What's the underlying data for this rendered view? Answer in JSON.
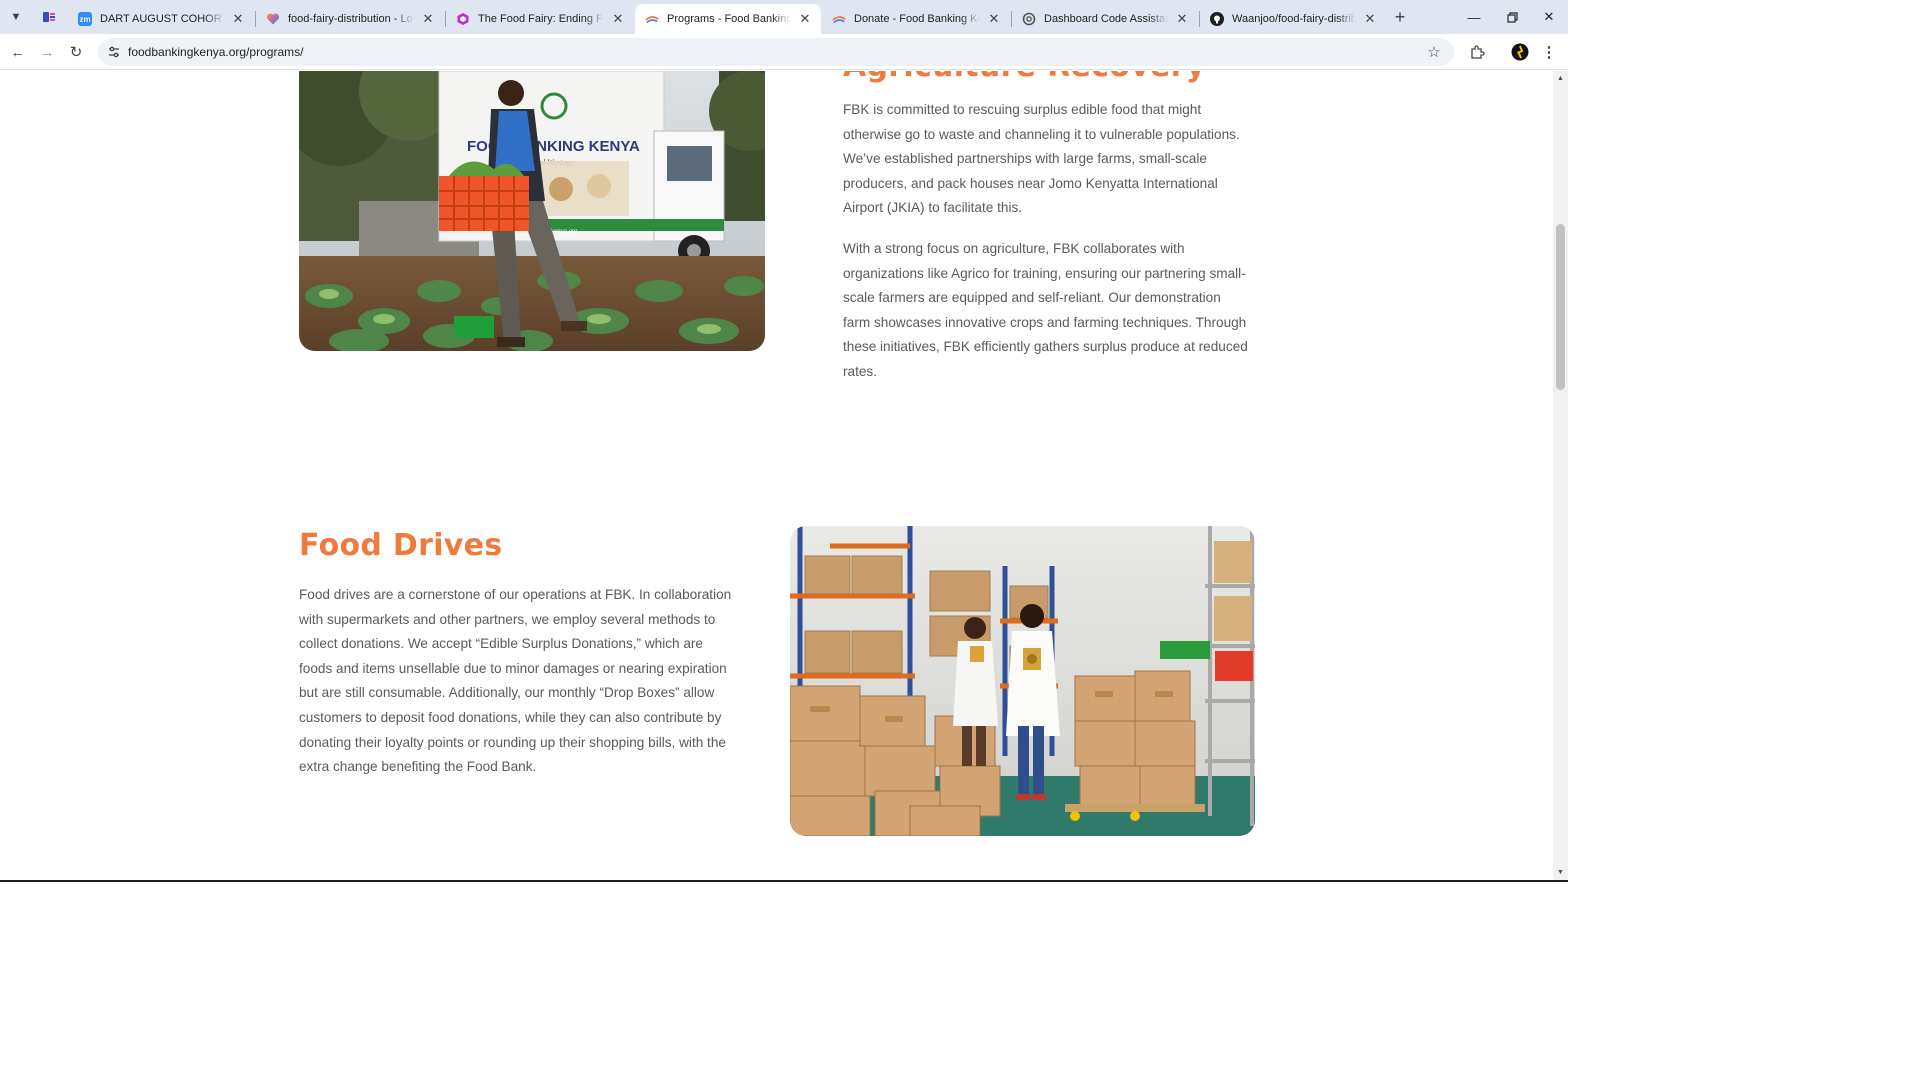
{
  "browser": {
    "tabs": [
      {
        "title": "",
        "favicon": "pinned-app-icon",
        "active": false
      },
      {
        "title": "DART AUGUST COHORT SESSION",
        "favicon": "zoom-icon",
        "active": false
      },
      {
        "title": "food-fairy-distribution - Lovable",
        "favicon": "lovable-heart-icon",
        "active": false
      },
      {
        "title": "The Food Fairy: Ending Food Waste",
        "favicon": "hexagon-logo-icon",
        "active": false
      },
      {
        "title": "Programs - Food Banking Kenya",
        "favicon": "fbk-logo-icon",
        "active": true
      },
      {
        "title": "Donate - Food Banking Kenya",
        "favicon": "fbk-logo-icon",
        "active": false
      },
      {
        "title": "Dashboard Code Assistance",
        "favicon": "openai-icon",
        "active": false
      },
      {
        "title": "Waanjoo/food-fairy-distribution",
        "favicon": "github-icon",
        "active": false
      }
    ],
    "new_tab": "+",
    "url": "foodbankingkenya.org/programs/"
  },
  "page": {
    "agri": {
      "title_partial": "Agriculture Recovery",
      "p1": "FBK is committed to rescuing surplus edible food that might otherwise go to waste and channeling it to vulnerable populations. We’ve established partnerships with large farms, small-scale producers, and pack houses near Jomo Kenyatta International Airport (JKIA) to facilitate this.",
      "p2": "With a strong focus on agriculture, FBK collaborates with organizations like Agrico for training, ensuring our partnering small-scale farmers are equipped and self-reliant. Our demonstration farm showcases innovative crops and farming techniques. Through these initiatives, FBK efficiently gathers surplus produce at reduced rates.",
      "truck_logo_text": "FOOD BANKING KENYA",
      "truck_tagline": "Tackling Food Wastage",
      "truck_site": "www.foodbankingkenya.org"
    },
    "drives": {
      "title": "Food Drives",
      "p1": "Food drives are a cornerstone of our operations at FBK. In collaboration with supermarkets and other partners, we employ several methods to collect donations. We accept “Edible Surplus Donations,” which are foods and items unsellable due to minor damages or nearing expiration but are still consumable. Additionally, our monthly “Drop Boxes” allow customers to deposit food donations, while they can also contribute by donating their loyalty points or rounding up their shopping bills, with the extra change benefiting the Food Bank."
    }
  },
  "colors": {
    "accent": "#f07a3c",
    "body_text": "#5a5a5a",
    "tabstrip": "#dfe6f2"
  }
}
